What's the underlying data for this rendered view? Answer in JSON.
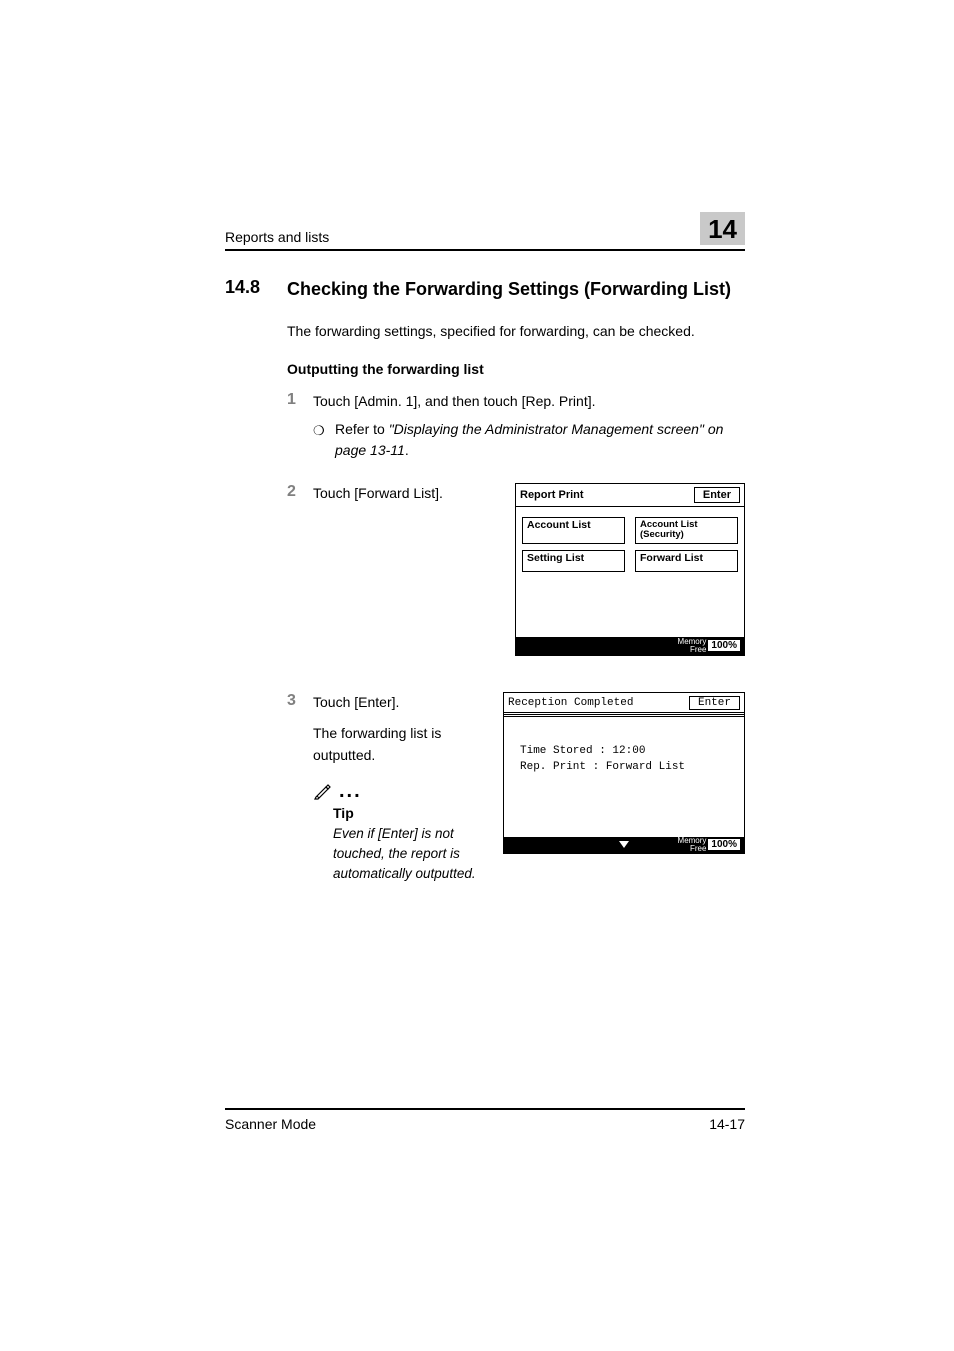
{
  "header": {
    "running_head": "Reports and lists",
    "chapter_number": "14"
  },
  "section": {
    "number": "14.8",
    "title": "Checking the Forwarding Settings (Forwarding List)",
    "intro": "The forwarding settings, specified for forwarding, can be checked.",
    "subhead": "Outputting the forwarding list"
  },
  "steps": {
    "s1": {
      "num": "1",
      "text": "Touch [Admin. 1], and then touch [Rep. Print].",
      "bullet": "❍",
      "ref_prefix": "Refer to ",
      "ref_italic": "\"Displaying the Administrator Management screen\" on page 13-11",
      "ref_suffix": "."
    },
    "s2": {
      "num": "2",
      "text": "Touch [Forward List]."
    },
    "s3": {
      "num": "3",
      "text": "Touch [Enter].",
      "result": "The forwarding list is outputted.",
      "tip_label": "Tip",
      "tip_text": "Even if [Enter] is not touched, the report is automatically outputted."
    }
  },
  "panel1": {
    "title": "Report Print",
    "enter": "Enter",
    "buttons": {
      "b1": "Account List",
      "b2": "Account List (Security)",
      "b3": "Setting List",
      "b4": "Forward List"
    },
    "mem_label_1": "Memory",
    "mem_label_2": "Free",
    "mem_pct": "100%"
  },
  "panel2": {
    "title": "Reception Completed",
    "enter": "Enter",
    "line1": "Time Stored : 12:00",
    "line2": "Rep. Print : Forward List",
    "mem_label_1": "Memory",
    "mem_label_2": "Free",
    "mem_pct": "100%"
  },
  "footer": {
    "left": "Scanner Mode",
    "right": "14-17"
  }
}
